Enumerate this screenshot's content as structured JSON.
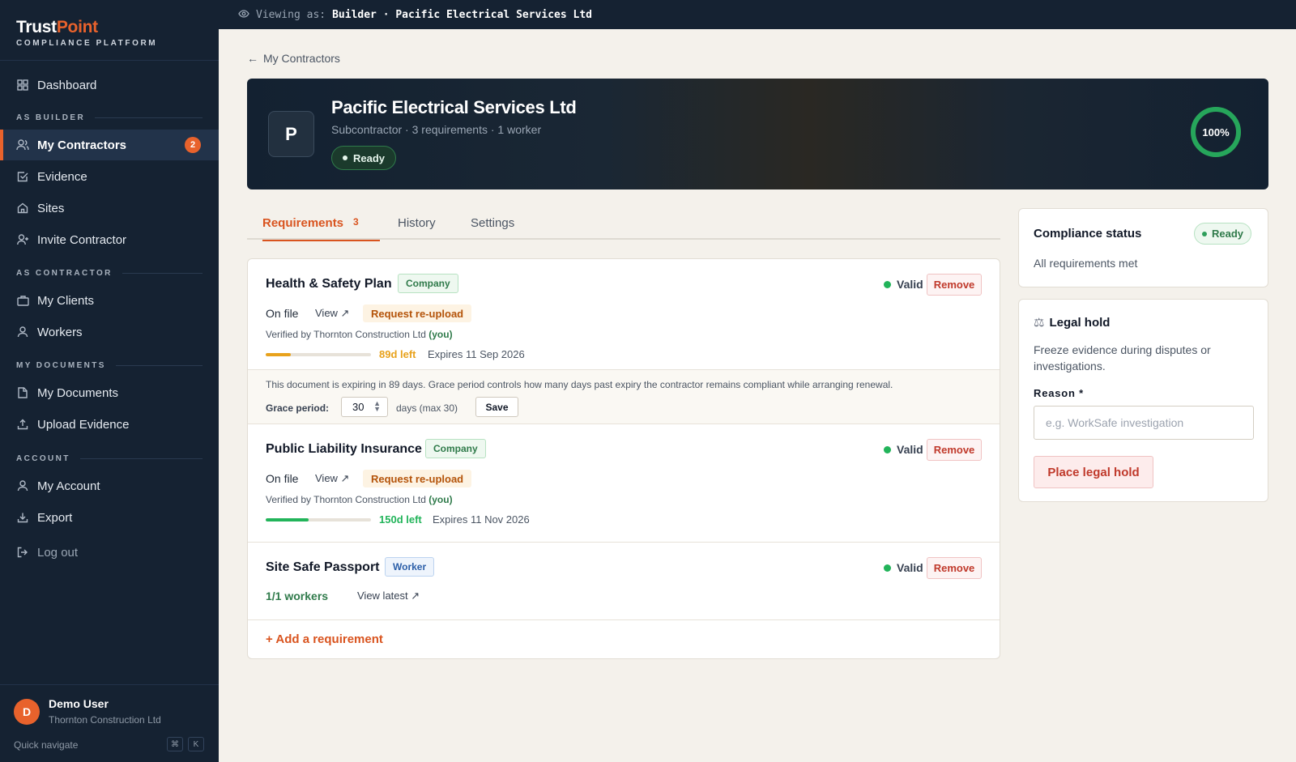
{
  "brand": {
    "name_part1": "Trust",
    "name_part2": "Point",
    "subtitle": "COMPLIANCE PLATFORM"
  },
  "topbar": {
    "viewing_label": "Viewing as:",
    "viewing_value": "Builder · Pacific Electrical Services Ltd"
  },
  "sidebar": {
    "dashboard": "Dashboard",
    "section_builder": "AS BUILDER",
    "my_contractors": "My Contractors",
    "my_contractors_badge": "2",
    "evidence": "Evidence",
    "sites": "Sites",
    "invite_contractor": "Invite Contractor",
    "section_contractor": "AS CONTRACTOR",
    "my_clients": "My Clients",
    "workers": "Workers",
    "section_documents": "MY DOCUMENTS",
    "my_documents": "My Documents",
    "upload_evidence": "Upload Evidence",
    "section_account": "ACCOUNT",
    "my_account": "My Account",
    "export": "Export",
    "log_out": "Log out"
  },
  "user": {
    "initial": "D",
    "name": "Demo User",
    "org": "Thornton Construction Ltd",
    "quick_navigate": "Quick navigate",
    "kbd1": "⌘",
    "kbd2": "K"
  },
  "back_link": "My Contractors",
  "contractor": {
    "initial": "P",
    "name": "Pacific Electrical Services Ltd",
    "subtitle": "Subcontractor · 3 requirements · 1 worker",
    "status": "Ready",
    "compliance_percent": 100,
    "compliance_label": "100%"
  },
  "tabs": [
    {
      "label": "Requirements",
      "count": "3"
    },
    {
      "label": "History"
    },
    {
      "label": "Settings"
    }
  ],
  "requirements": [
    {
      "title": "Health & Safety Plan",
      "tag": "Company",
      "status": "Valid",
      "remove": "Remove",
      "on_file": "On file",
      "view": "View ↗",
      "reupload": "Request re-upload",
      "verified_prefix": "Verified by Thornton Construction Ltd",
      "verified_you": "(you)",
      "days_left": "89d left",
      "expires": "Expires 11 Sep 2026",
      "remaining_fraction": 0.24
    },
    {
      "title": "Public Liability Insurance",
      "tag": "Company",
      "status": "Valid",
      "remove": "Remove",
      "on_file": "On file",
      "view": "View ↗",
      "reupload": "Request re-upload",
      "verified_prefix": "Verified by Thornton Construction Ltd",
      "verified_you": "(you)",
      "days_left": "150d left",
      "expires": "Expires 11 Nov 2026",
      "remaining_fraction": 0.41
    },
    {
      "title": "Site Safe Passport",
      "tag": "Worker",
      "status": "Valid",
      "remove": "Remove",
      "workers": "1/1 workers",
      "view_latest": "View latest ↗"
    }
  ],
  "grace": {
    "note": "This document is expiring in 89 days. Grace period controls how many days past expiry the contractor remains compliant while arranging renewal.",
    "label": "Grace period:",
    "value": "30",
    "unit": "days (max 30)",
    "save": "Save"
  },
  "add_requirement": "+ Add a requirement",
  "compliance_status": {
    "title": "Compliance status",
    "badge": "Ready",
    "text": "All requirements met"
  },
  "legal_hold": {
    "title": "Legal hold",
    "description": "Freeze evidence during disputes or investigations.",
    "reason_label": "Reason *",
    "reason_placeholder": "e.g. WorkSafe investigation",
    "button": "Place legal hold"
  },
  "colors": {
    "accent": "#e8622c",
    "valid": "#22b45a",
    "warning": "#e8a21c",
    "sidebar": "#152232"
  }
}
